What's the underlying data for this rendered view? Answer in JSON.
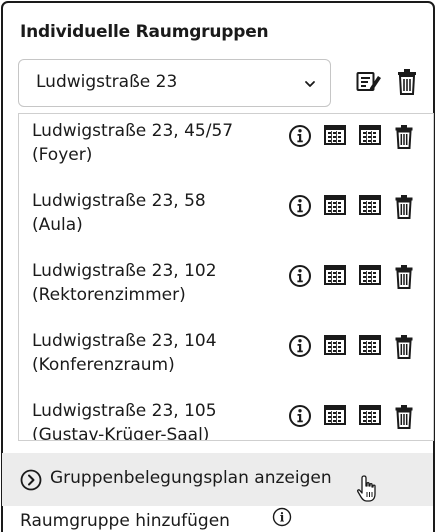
{
  "panel": {
    "title": "Individuelle Raumgruppen"
  },
  "group_select": {
    "selected": "Ludwigstraße 23"
  },
  "rooms": [
    {
      "line1": "Ludwigstraße 23, 45/57",
      "line2": "(Foyer)"
    },
    {
      "line1": "Ludwigstraße 23, 58",
      "line2": "(Aula)"
    },
    {
      "line1": "Ludwigstraße 23, 102",
      "line2": "(Rektorenzimmer)"
    },
    {
      "line1": "Ludwigstraße 23, 104",
      "line2": "(Konferenzraum)"
    },
    {
      "line1": "Ludwigstraße 23, 105",
      "line2": "(Gustav-Krüger-Saal)"
    }
  ],
  "footer": {
    "show_plan_label": "Gruppenbelegungsplan anzeigen"
  },
  "add_group": {
    "label": "Raumgruppe hinzufügen"
  },
  "icons": {
    "edit": "edit-list-icon",
    "delete": "trash-icon",
    "info": "info-icon",
    "calendar": "calendar-grid-icon",
    "expand": "chevron-right-circle-icon",
    "dropdown": "chevron-down-icon",
    "cursor": "hand-pointer-icon"
  },
  "colors": {
    "text": "#1a1a1a",
    "border": "#1a1a1a",
    "footer_bg": "#ececec"
  }
}
